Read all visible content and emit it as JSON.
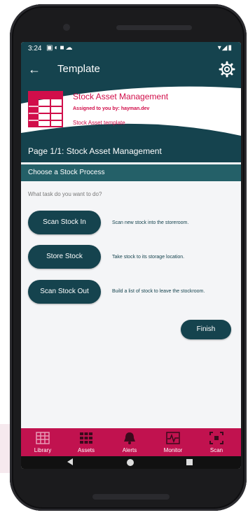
{
  "status_bar": {
    "time": "3:24",
    "left_icons": [
      "image-icon",
      "sync-icon",
      "lock-icon",
      "cloud-icon"
    ],
    "right_icons": [
      "wifi-icon",
      "signal-icon",
      "battery-icon"
    ]
  },
  "app_bar": {
    "title": "Template",
    "back_icon": "arrow-left-icon",
    "settings_icon": "gear-icon"
  },
  "header": {
    "title": "Stock Asset Management",
    "assigned": "Assigned to you by: hayman.dev",
    "template_name": "Stock Asset template",
    "logo_icon": "table-grid-icon"
  },
  "page": {
    "title": "Page 1/1: Stock Asset Management"
  },
  "section": {
    "title": "Choose a Stock Process"
  },
  "question": "What task do you want to do?",
  "tasks": [
    {
      "label": "Scan Stock In",
      "description": "Scan new stock into the storeroom."
    },
    {
      "label": "Store Stock",
      "description": "Take stock to its storage location."
    },
    {
      "label": "Scan Stock Out",
      "description": "Build a list of stock to leave the stockroom."
    }
  ],
  "finish_label": "Finish",
  "bottom_nav": [
    {
      "label": "Library",
      "icon": "library-grid-icon",
      "active": true
    },
    {
      "label": "Assets",
      "icon": "assets-grid-icon",
      "active": false
    },
    {
      "label": "Alerts",
      "icon": "bell-icon",
      "active": false
    },
    {
      "label": "Monitor",
      "icon": "monitor-pulse-icon",
      "active": false
    },
    {
      "label": "Scan",
      "icon": "scan-frame-icon",
      "active": false
    }
  ],
  "colors": {
    "primary": "#15434e",
    "section": "#246068",
    "accent": "#d10e4a",
    "nav": "#c1124f"
  }
}
